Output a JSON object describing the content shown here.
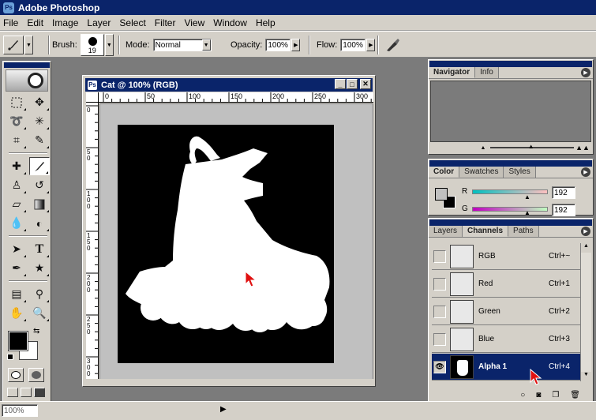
{
  "app": {
    "title": "Adobe Photoshop"
  },
  "menu": [
    "File",
    "Edit",
    "Image",
    "Layer",
    "Select",
    "Filter",
    "View",
    "Window",
    "Help"
  ],
  "options": {
    "brush_label": "Brush:",
    "brush_size": "19",
    "mode_label": "Mode:",
    "mode_value": "Normal",
    "opacity_label": "Opacity:",
    "opacity_value": "100%",
    "flow_label": "Flow:",
    "flow_value": "100%"
  },
  "document": {
    "title": "Cat @ 100% (RGB)",
    "ruler_h": [
      "0",
      "50",
      "100",
      "150",
      "200",
      "250",
      "300"
    ],
    "ruler_v": [
      "0",
      "50",
      "100",
      "150",
      "200",
      "250",
      "300"
    ]
  },
  "navigator_panel": {
    "tabs": [
      "Navigator",
      "Info"
    ]
  },
  "color_panel": {
    "tabs": [
      "Color",
      "Swatches",
      "Styles"
    ],
    "r_label": "R",
    "r_value": "192",
    "g_label": "G",
    "g_value": "192"
  },
  "channels_panel": {
    "tabs": [
      "Layers",
      "Channels",
      "Paths"
    ],
    "channels": [
      {
        "name": "RGB",
        "shortcut": "Ctrl+~",
        "visible": false,
        "selected": false
      },
      {
        "name": "Red",
        "shortcut": "Ctrl+1",
        "visible": false,
        "selected": false
      },
      {
        "name": "Green",
        "shortcut": "Ctrl+2",
        "visible": false,
        "selected": false
      },
      {
        "name": "Blue",
        "shortcut": "Ctrl+3",
        "visible": false,
        "selected": false
      },
      {
        "name": "Alpha 1",
        "shortcut": "Ctrl+4",
        "visible": true,
        "selected": true
      }
    ]
  },
  "status": {
    "zoom": "100%"
  },
  "colors": {
    "titlebar": "#0a246a",
    "chrome": "#d4d0c8",
    "workspace": "#7b7b7b",
    "cursor_arrow": "#e01010"
  }
}
